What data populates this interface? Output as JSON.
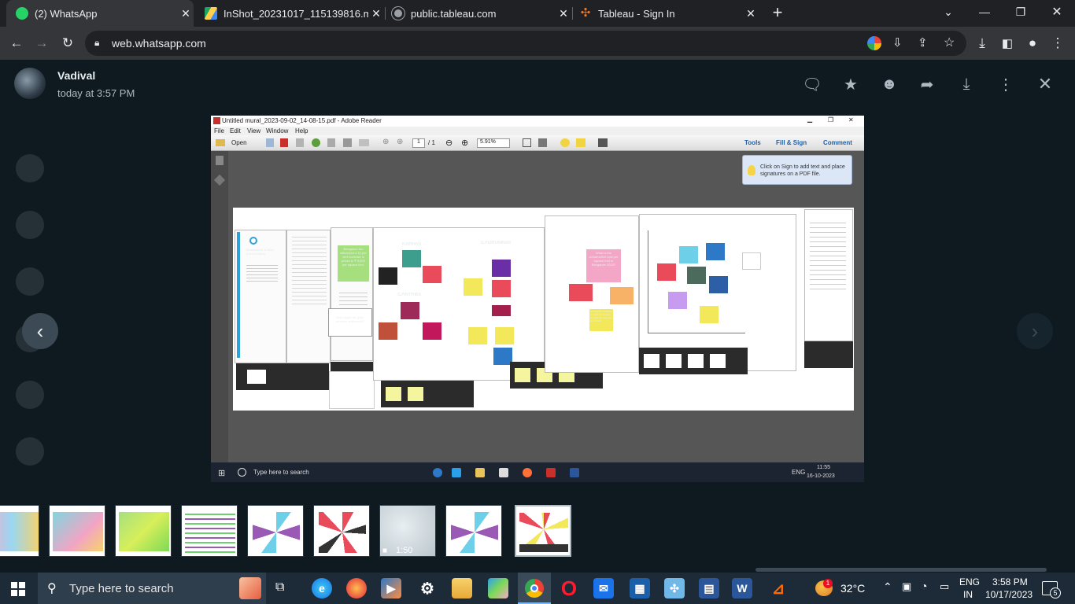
{
  "browser": {
    "tabs": [
      {
        "label": "(2) WhatsApp",
        "icon": "whatsapp-icon",
        "color": "#25d366",
        "active": true
      },
      {
        "label": "InShot_20231017_115139816.mp4",
        "icon": "google-drive-icon",
        "color": "#f4b400",
        "active": false
      },
      {
        "label": "public.tableau.com",
        "icon": "globe-icon",
        "color": "#9aa0a6",
        "active": false
      },
      {
        "label": "Tableau - Sign In",
        "icon": "tableau-icon",
        "color": "#e8762d",
        "active": false
      }
    ],
    "url": "web.whatsapp.com"
  },
  "viewer": {
    "sender_name": "Vadival",
    "timestamp": "today at 3:57 PM",
    "video_duration": "1:50"
  },
  "shot": {
    "window_title": "Untitled mural_2023-09-02_14-08-15.pdf - Adobe Reader",
    "menu": [
      "File",
      "Edit",
      "View",
      "Window",
      "Help"
    ],
    "open_label": "Open",
    "page_current": "1",
    "page_total": "/ 1",
    "zoom": "5.91%",
    "tools_label": "Tools",
    "fill_sign_label": "Fill & Sign",
    "comment_label": "Comment",
    "tip_text": "Click on Sign to add text and place signatures on a PDF file.",
    "search_placeholder": "Type here to search",
    "lang": "ENG",
    "clock_time": "11:55",
    "clock_date": "16-10-2023",
    "mural": {
      "brainstorm_title": "Brainstorm & idea prioritization",
      "stat_note": "Bengaluru too witnessed a 10 per cent increase in prices to ₹ 5,600 per square feet.",
      "question": "How might we [your problem statement]?",
      "name1": "K.NITHIYA",
      "name2": "G.PERIYANNAN",
      "name3": "G.PAVITHRA",
      "cost_note": "What is the construction cost per square foot in Bangalore 2023?",
      "avg_note": "On average, building a 1,000 sq ft house in India can cost you Rs 15 lakh."
    }
  },
  "taskbar": {
    "search_placeholder": "Type here to search",
    "temperature": "32°C",
    "lang_line1": "ENG",
    "lang_line2": "IN",
    "time": "3:58 PM",
    "date": "10/17/2023",
    "notification_count": "5",
    "weather_badge": "1"
  }
}
